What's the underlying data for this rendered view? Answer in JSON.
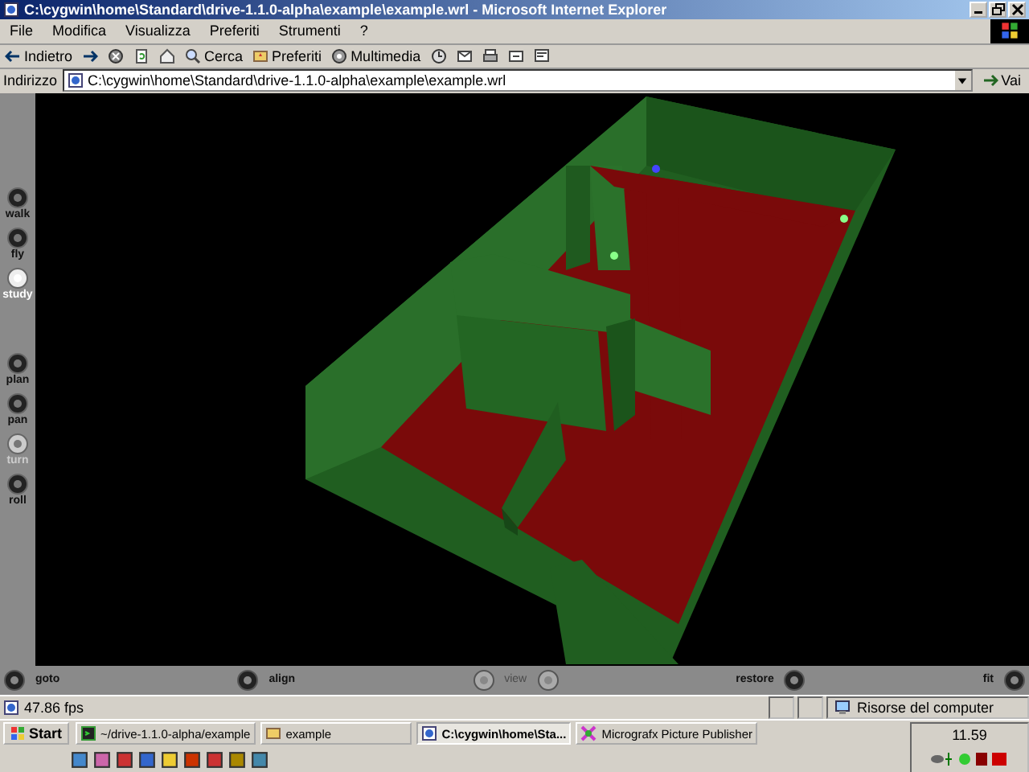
{
  "window": {
    "title": "C:\\cygwin\\home\\Standard\\drive-1.1.0-alpha\\example\\example.wrl - Microsoft Internet Explorer"
  },
  "menu": [
    "File",
    "Modifica",
    "Visualizza",
    "Preferiti",
    "Strumenti",
    "?"
  ],
  "toolbar": [
    {
      "kind": "back",
      "label": "Indietro"
    },
    {
      "kind": "forward"
    },
    {
      "kind": "stop"
    },
    {
      "kind": "refresh"
    },
    {
      "kind": "home"
    },
    {
      "kind": "search",
      "label": "Cerca"
    },
    {
      "kind": "favorites",
      "label": "Preferiti"
    },
    {
      "kind": "media",
      "label": "Multimedia"
    },
    {
      "kind": "history"
    },
    {
      "kind": "mail"
    },
    {
      "kind": "print"
    },
    {
      "kind": "edit"
    },
    {
      "kind": "discuss"
    }
  ],
  "address": {
    "label": "Indirizzo",
    "value": "C:\\cygwin\\home\\Standard\\drive-1.1.0-alpha\\example\\example.wrl",
    "go": "Vai"
  },
  "viewer": {
    "modes": [
      {
        "label": "walk",
        "selected": false,
        "disabled": false
      },
      {
        "label": "fly",
        "selected": false,
        "disabled": false
      },
      {
        "label": "study",
        "selected": true,
        "disabled": false
      },
      {
        "label": "plan",
        "selected": false,
        "disabled": false
      },
      {
        "label": "pan",
        "selected": false,
        "disabled": false
      },
      {
        "label": "turn",
        "selected": false,
        "disabled": true
      },
      {
        "label": "roll",
        "selected": false,
        "disabled": false
      }
    ],
    "bottom": [
      {
        "kind": "goto",
        "label": "goto",
        "disabled": false
      },
      {
        "kind": "align",
        "label": "align",
        "disabled": false
      },
      {
        "kind": "view",
        "label": "view",
        "disabled": true
      },
      {
        "kind": "restore",
        "label": "restore",
        "disabled": false
      },
      {
        "kind": "fit",
        "label": "fit",
        "disabled": false
      }
    ]
  },
  "status_bar": {
    "text": "47.86 fps",
    "zone": "Risorse del computer"
  },
  "taskbar": {
    "start": "Start",
    "tasks": [
      {
        "label": "~/drive-1.1.0-alpha/example",
        "selected": false
      },
      {
        "label": "example",
        "selected": false
      },
      {
        "label": "C:\\cygwin\\home\\Sta...",
        "selected": true
      },
      {
        "label": "Micrografx Picture Publisher",
        "selected": false
      }
    ],
    "clock": "11.59"
  }
}
